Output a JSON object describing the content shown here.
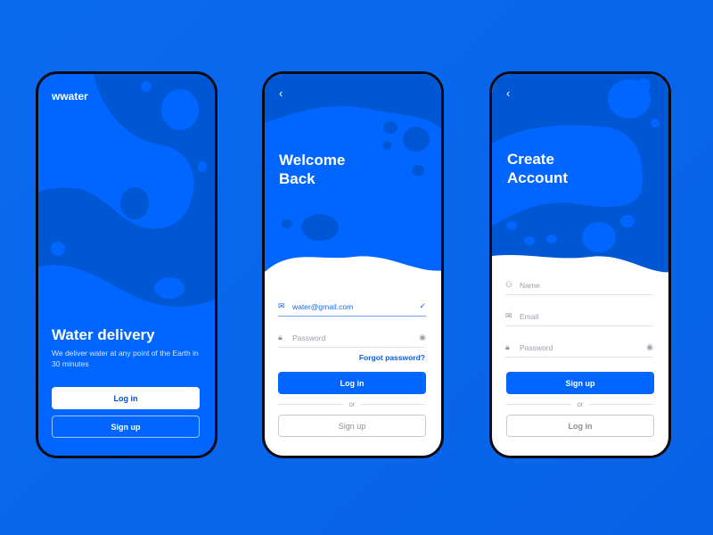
{
  "colors": {
    "primary": "#0066ff",
    "dark": "#0057d4",
    "frame": "#0a0a14"
  },
  "screen1": {
    "logo": "wwater",
    "title": "Water delivery",
    "subtitle": "We deliver water at any point of the Earth in 30 minutes",
    "login": "Log in",
    "signup": "Sign up"
  },
  "screen2": {
    "back_icon": "chevron-left",
    "title_line1": "Welcome",
    "title_line2": "Back",
    "email_value": "water@gmail.com",
    "password_placeholder": "Password",
    "forgot": "Forgot password?",
    "login": "Log in",
    "or": "or",
    "signup": "Sign up"
  },
  "screen3": {
    "back_icon": "chevron-left",
    "title_line1": "Create",
    "title_line2": "Account",
    "name_placeholder": "Name",
    "email_placeholder": "Email",
    "password_placeholder": "Password",
    "signup": "Sign up",
    "or": "or",
    "login": "Log in"
  }
}
